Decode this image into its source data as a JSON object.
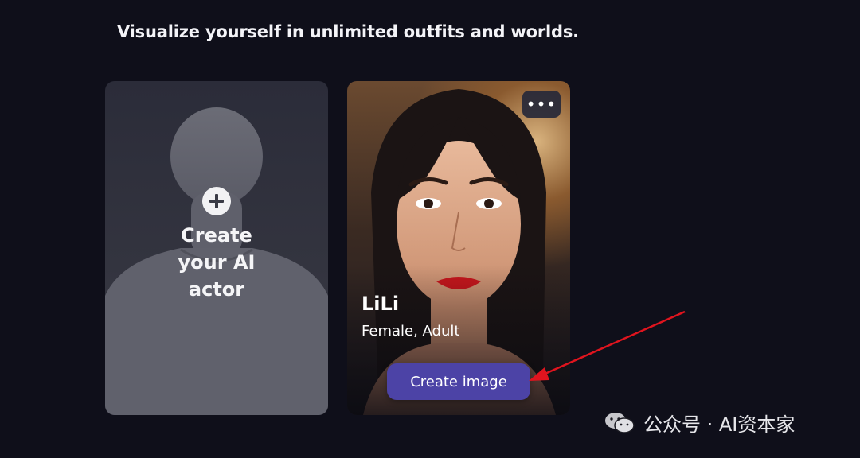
{
  "page": {
    "headline": "Visualize yourself in unlimited outfits and worlds."
  },
  "create_card": {
    "label": "Create your AI actor",
    "plus_icon": "plus-circle-icon"
  },
  "actor_card": {
    "name": "LiLi",
    "meta": "Female, Adult",
    "more_icon": "more-horizontal-icon",
    "more_glyph": "•••",
    "create_button_label": "Create image"
  },
  "annotation": {
    "arrow_color": "#e0141e"
  },
  "watermark": {
    "text": "公众号 · AI资本家",
    "icon": "wechat-icon"
  },
  "colors": {
    "background": "#0f0f1a",
    "accent": "#4c43a6"
  }
}
